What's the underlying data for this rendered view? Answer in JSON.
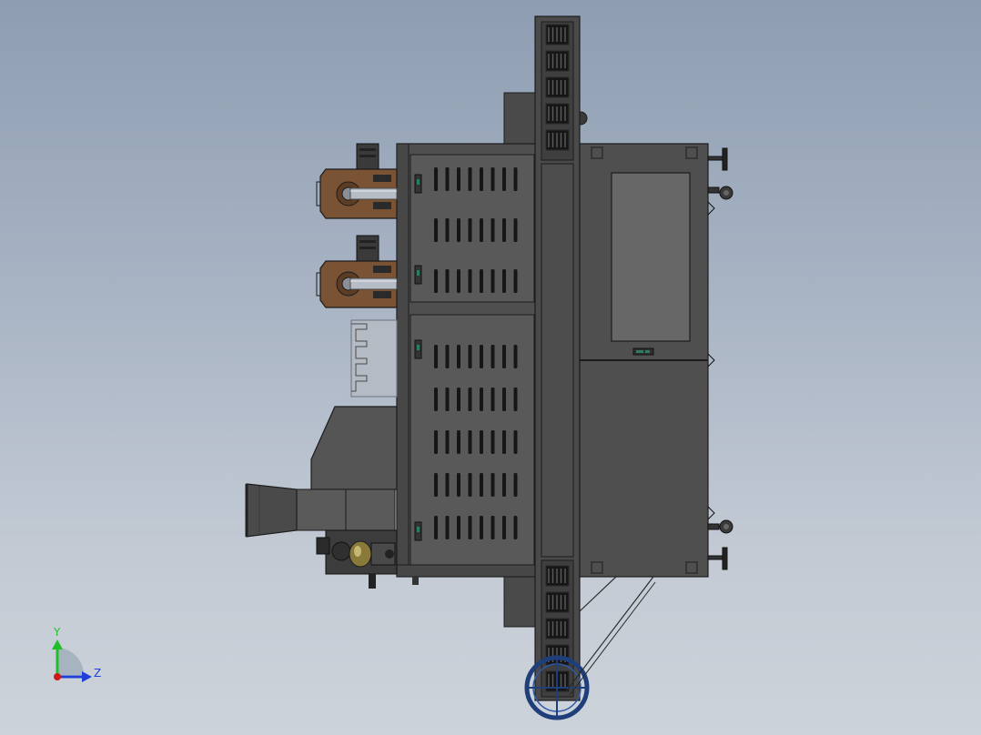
{
  "viewport": {
    "background_top": "#8e9db2",
    "background_bottom": "#cdd3da"
  },
  "model": {
    "body_color": "#4f4f4f",
    "panel_color": "#595959",
    "edge_color": "#1c1c1c",
    "blower_color": "#7a5234",
    "duct_color": "#b7bdc6",
    "handwheel_color": "#1f3f7a",
    "slot_color": "#161616"
  },
  "triad": {
    "y_label": "Y",
    "z_label": "Z",
    "y_color": "#1fbf2a",
    "z_color": "#1f3fd6",
    "x_color": "#d01818"
  }
}
